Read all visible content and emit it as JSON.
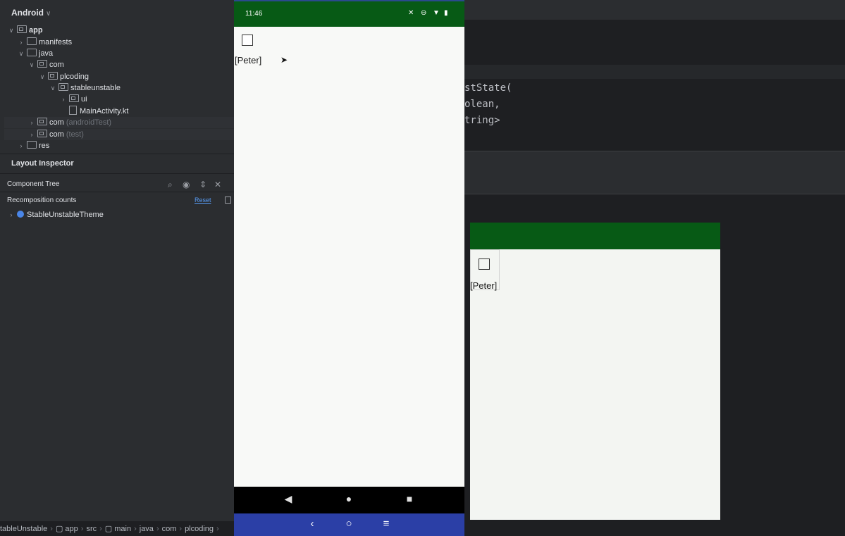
{
  "project": {
    "header": "Android",
    "tree": [
      {
        "label": "app",
        "bold": true
      },
      {
        "label": "manifests"
      },
      {
        "label": "java"
      },
      {
        "label": "com"
      },
      {
        "label": "plcoding"
      },
      {
        "label": "stableunstable"
      },
      {
        "label": "ui"
      },
      {
        "label": "MainActivity.kt"
      },
      {
        "label": "com",
        "suffix": "(androidTest)"
      },
      {
        "label": "com",
        "suffix": "(test)"
      },
      {
        "label": "res"
      }
    ]
  },
  "layout_inspector": {
    "title": "Layout Inspector",
    "component_tree_label": "Component Tree",
    "recomposition_label": "Recomposition counts",
    "reset_label": "Reset",
    "root_node": "StableUnstableTheme"
  },
  "breadcrumb": [
    "tableUnstable",
    "app",
    "src",
    "main",
    "java",
    "com",
    "plcoding"
  ],
  "code_lines": [
    "stState(",
    "olean,",
    "tring>"
  ],
  "phone": {
    "time": "11:46",
    "name_text": "[Peter]"
  },
  "preview": {
    "name_text": "[Peter]"
  },
  "colors": {
    "status_bar": "#075a15",
    "host_nav": "#2b3fa6",
    "ide_panel": "#2b2d30",
    "ide_bg": "#1e1f22"
  }
}
